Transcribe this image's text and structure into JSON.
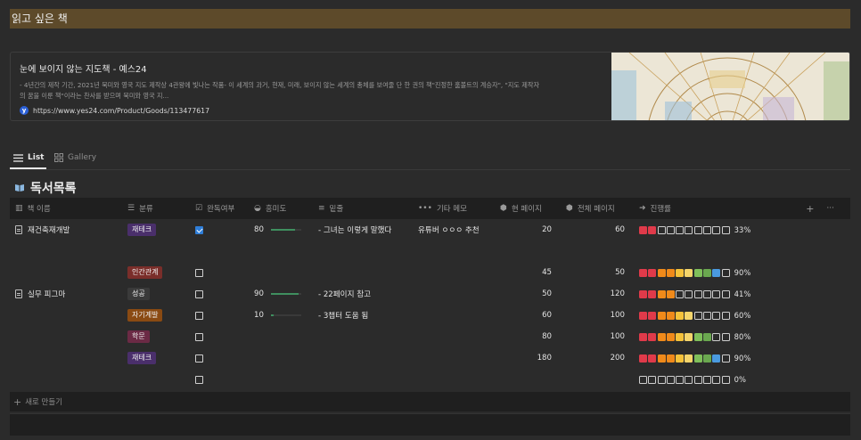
{
  "heading": "읽고 싶은 책",
  "bookmark": {
    "title": "눈에 보이지 않는 지도책 - 예스24",
    "desc_line1": "- 4년간의 제작 기간, 2021년 북미와 영국 지도 제작상 4관왕에 빛나는 작품- 이 세계의 과거, 현재, 미래, 보이지 않는 세계의 총체를 보여줄 단 한 권의 책\"진정한 훔볼트의 계승자\", \"지도 제작자",
    "desc_line2": "의 꿈을 이룬 책\"이라는 찬사를 받으며 북미와 영국 지...",
    "url": "https://www.yes24.com/Product/Goods/113477617",
    "favicon": "y"
  },
  "tabs": [
    {
      "label": "List",
      "icon": "list-icon"
    },
    {
      "label": "Gallery",
      "icon": "gallery-icon"
    }
  ],
  "db_title": "독서목록",
  "columns": {
    "title": "책 이름",
    "category": "분류",
    "done": "완독여부",
    "interest": "흥미도",
    "underline": "밑줄",
    "memo": "기타 메모",
    "current": "현 페이지",
    "total": "전체 페이지",
    "progress": "진행률"
  },
  "colors": {
    "tag_jaetech": "#4a2f6b",
    "tag_human": "#7a2e2a",
    "tag_success": "#3a3a3a",
    "tag_self": "#8a4a12",
    "tag_study": "#6b2a45",
    "prog_palette": [
      "#e03a4a",
      "#e03a4a",
      "#f08a1a",
      "#f08a1a",
      "#f5c23a",
      "#f5d56b",
      "#7fbf5a",
      "#6aa84f",
      "#4a9ae0",
      "#7a5fc8"
    ]
  },
  "rows": [
    {
      "title": "재건축재개발",
      "category": "재테크",
      "cat_color": "#4a2f6b",
      "done": true,
      "interest": "80",
      "interest_frac": 0.8,
      "underline": "- 그녀는 이렇게 말했다",
      "memo": "유튜버 ㅇㅇㅇ 추천",
      "current": "20",
      "total": "60",
      "filled": 2,
      "pct": "33%"
    },
    {
      "title": "",
      "category": "",
      "cat_color": "",
      "done": null,
      "interest": "",
      "interest_frac": 0,
      "underline": "",
      "memo": "",
      "current": "",
      "total": "",
      "filled": null,
      "pct": ""
    },
    {
      "title": "",
      "category": "인간관계",
      "cat_color": "#7a2e2a",
      "done": false,
      "interest": "",
      "interest_frac": 0,
      "underline": "",
      "memo": "",
      "current": "45",
      "total": "50",
      "filled": 9,
      "pct": "90%"
    },
    {
      "title": "실무 피그마",
      "category": "성공",
      "cat_color": "#3a3a3a",
      "done": false,
      "interest": "90",
      "interest_frac": 0.9,
      "underline": "- 22페이지 참고",
      "memo": "",
      "current": "50",
      "total": "120",
      "filled": 4,
      "pct": "41%"
    },
    {
      "title": "",
      "category": "자기계발",
      "cat_color": "#8a4a12",
      "done": false,
      "interest": "10",
      "interest_frac": 0.1,
      "underline": "- 3챕터 도움 됨",
      "memo": "",
      "current": "60",
      "total": "100",
      "filled": 6,
      "pct": "60%"
    },
    {
      "title": "",
      "category": "학문",
      "cat_color": "#6b2a45",
      "done": false,
      "interest": "",
      "interest_frac": 0,
      "underline": "",
      "memo": "",
      "current": "80",
      "total": "100",
      "filled": 8,
      "pct": "80%"
    },
    {
      "title": "",
      "category": "재테크",
      "cat_color": "#4a2f6b",
      "done": false,
      "interest": "",
      "interest_frac": 0,
      "underline": "",
      "memo": "",
      "current": "180",
      "total": "200",
      "filled": 9,
      "pct": "90%"
    },
    {
      "title": "",
      "category": "",
      "cat_color": "",
      "done": false,
      "interest": "",
      "interest_frac": 0,
      "underline": "",
      "memo": "",
      "current": "",
      "total": "",
      "filled": 0,
      "pct": "0%"
    }
  ],
  "new_row_label": "새로 만들기"
}
